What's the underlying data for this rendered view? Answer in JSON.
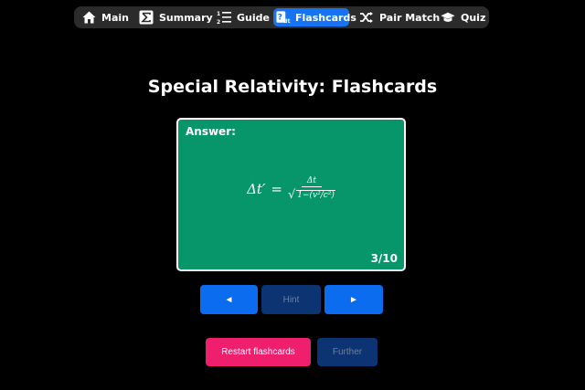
{
  "nav": {
    "items": [
      {
        "label": "Main",
        "icon": "home-icon"
      },
      {
        "label": "Summary",
        "icon": "sigma-icon"
      },
      {
        "label": "Guide",
        "icon": "numbered-list-icon"
      },
      {
        "label": "Flashcards",
        "icon": "flashcards-icon",
        "active": true
      },
      {
        "label": "Pair Match",
        "icon": "shuffle-icon"
      },
      {
        "label": "Quiz",
        "icon": "graduation-cap-icon"
      }
    ]
  },
  "page": {
    "title": "Special Relativity: Flashcards"
  },
  "card": {
    "label": "Answer:",
    "formula": {
      "lhs": "Δt′",
      "eq": "=",
      "numerator": "Δt",
      "denominator_prefix": "1−",
      "radicand": "1−(v²/c²)"
    },
    "counter": "3/10"
  },
  "controls": {
    "prev_label": "◄",
    "hint_label": "Hint",
    "next_label": "►",
    "restart_label": "Restart flashcards",
    "further_label": "Further"
  },
  "colors": {
    "accent": "#1673f4",
    "card": "#069669",
    "restart": "#f01f6e",
    "disabled": "#0c3473"
  }
}
